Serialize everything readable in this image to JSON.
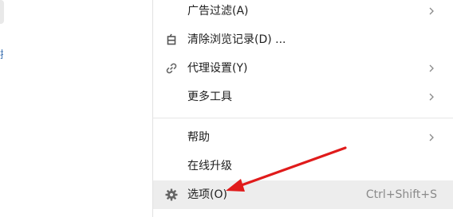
{
  "left": {
    "partial_text": "提"
  },
  "menu": {
    "items": [
      {
        "label": "广告过滤(A)",
        "submenu": true,
        "icon": null
      },
      {
        "label": "清除浏览记录(D) ...",
        "submenu": false,
        "icon": "clear-history-icon"
      },
      {
        "label": "代理设置(Y)",
        "submenu": true,
        "icon": "link-icon"
      },
      {
        "label": "更多工具",
        "submenu": true,
        "icon": null
      },
      {
        "label": "帮助",
        "submenu": true,
        "icon": null
      },
      {
        "label": "在线升级",
        "submenu": false,
        "icon": null
      },
      {
        "label": "选项(O)",
        "submenu": false,
        "icon": "gear-icon",
        "shortcut": "Ctrl+Shift+S",
        "highlighted": true
      }
    ]
  },
  "colors": {
    "annotation_arrow": "#e01b1b",
    "hover_bg": "#ededed"
  }
}
